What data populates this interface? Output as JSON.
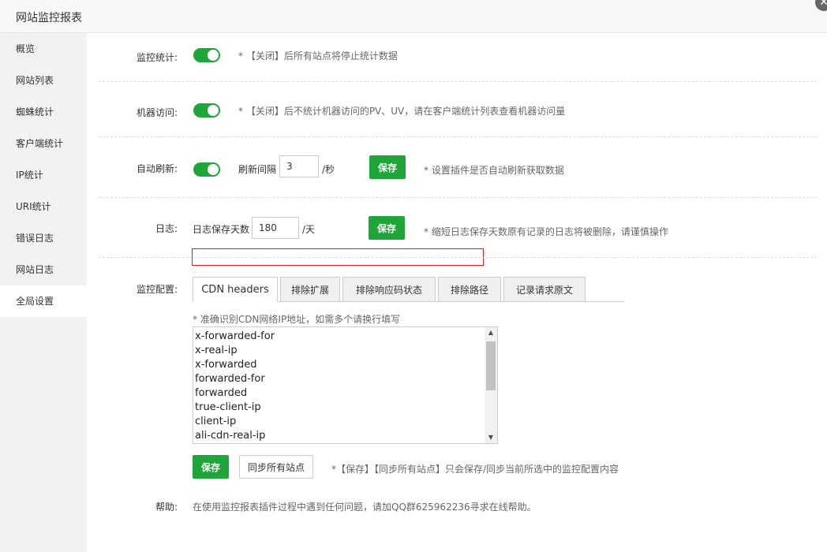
{
  "window": {
    "title": "网站监控报表",
    "close_glyph": "✕"
  },
  "sidebar": {
    "items": [
      {
        "label": "概览"
      },
      {
        "label": "网站列表"
      },
      {
        "label": "蜘蛛统计"
      },
      {
        "label": "客户端统计"
      },
      {
        "label": "IP统计"
      },
      {
        "label": "URI统计"
      },
      {
        "label": "错误日志"
      },
      {
        "label": "网站日志"
      },
      {
        "label": "全局设置",
        "active": true
      }
    ]
  },
  "settings": {
    "monitor_stats": {
      "label": "监控统计:",
      "enabled": true,
      "hint": "* 【关闭】后所有站点将停止统计数据"
    },
    "bot_access": {
      "label": "机器访问:",
      "enabled": true,
      "hint": "* 【关闭】后不统计机器访问的PV、UV，请在客户端统计列表查看机器访问量"
    },
    "auto_refresh": {
      "label": "自动刷新:",
      "enabled": true,
      "interval_label": "刷新间隔",
      "interval_value": "3",
      "unit": "/秒",
      "save_label": "保存",
      "hint": "* 设置插件是否自动刷新获取数据"
    },
    "log": {
      "label": "日志:",
      "days_label": "日志保存天数",
      "days_value": "180",
      "unit": "/天",
      "save_label": "保存",
      "hint": "* 缩短日志保存天数原有记录的日志将被删除，请谨慎操作"
    },
    "monitor_config": {
      "label": "监控配置:",
      "tabs": [
        {
          "label": "CDN headers",
          "active": true
        },
        {
          "label": "排除扩展"
        },
        {
          "label": "排除响应码状态"
        },
        {
          "label": "排除路径"
        },
        {
          "label": "记录请求原文"
        }
      ],
      "hint": "* 准确识别CDN网络IP地址，如需多个请换行填写",
      "headers": [
        "x-forwarded-for",
        "x-real-ip",
        "x-forwarded",
        "forwarded-for",
        "forwarded",
        "true-client-ip",
        "client-ip",
        "ali-cdn-real-ip"
      ],
      "save_label": "保存",
      "sync_label": "同步所有站点",
      "footer_hint": "*【保存】【同步所有站点】只会保存/同步当前所选中的监控配置内容"
    },
    "help": {
      "label": "帮助:",
      "text": "在使用监控报表插件过程中遇到任何问题，请加QQ群625962236寻求在线帮助。"
    }
  },
  "colors": {
    "accent": "#20a53a",
    "highlight": "#e02020"
  }
}
